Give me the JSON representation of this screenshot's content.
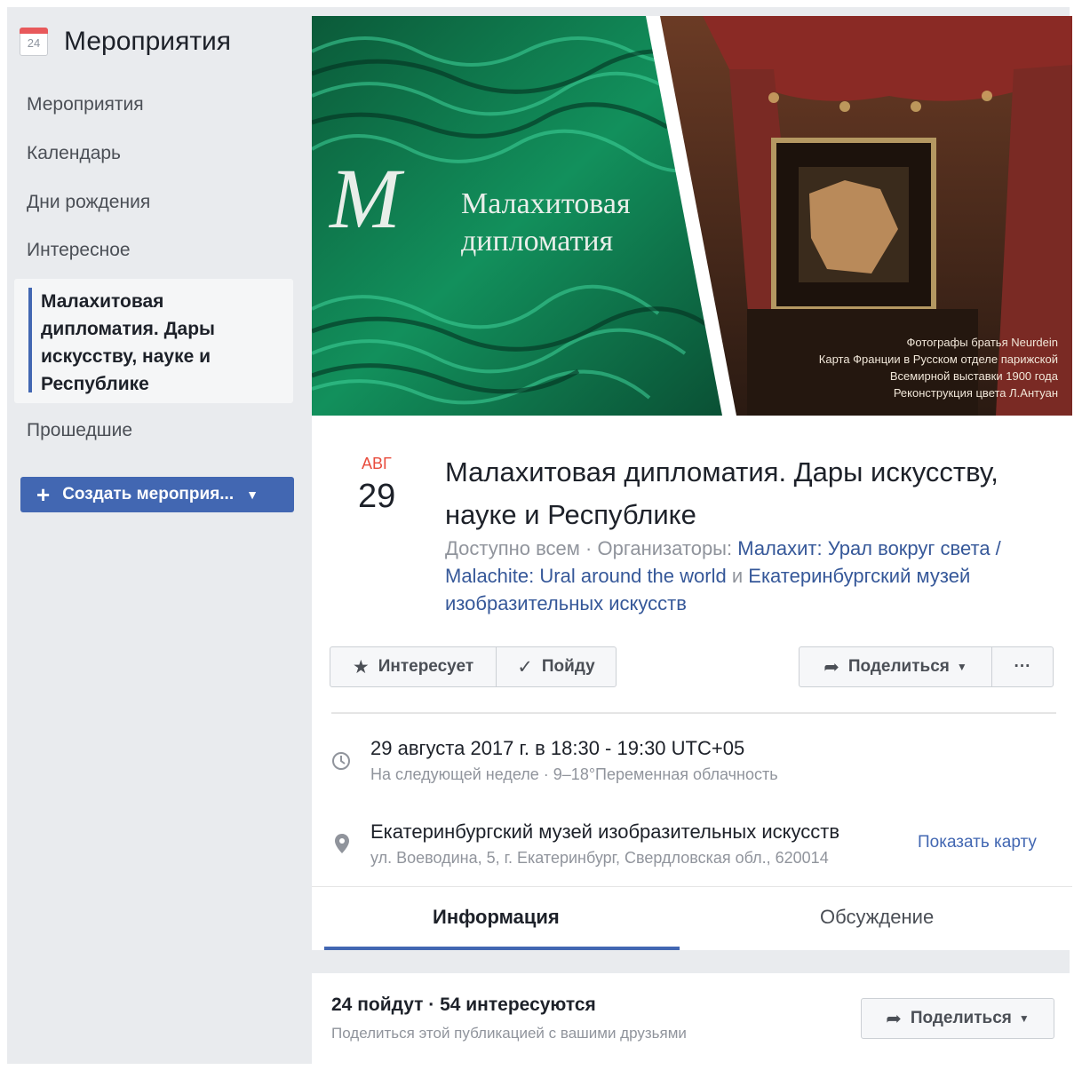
{
  "sidebar": {
    "icon_day": "24",
    "title": "Мероприятия",
    "items": [
      {
        "label": "Мероприятия"
      },
      {
        "label": "Календарь"
      },
      {
        "label": "Дни рождения"
      },
      {
        "label": "Интересное"
      },
      {
        "label": "Малахитовая дипломатия. Дары искусству, науке и Республике"
      },
      {
        "label": "Прошедшие"
      }
    ],
    "create_button": "Создать мероприя..."
  },
  "cover": {
    "title_line1": "Малахитовая",
    "title_line2": "дипломатия",
    "caption_lines": [
      "Фотографы братья Neurdein",
      "Карта Франции в Русском отделе парижской",
      "Всемирной выставки 1900 года",
      "Реконструкция цвета Л.Антуан"
    ]
  },
  "event": {
    "month": "АВГ",
    "day": "29",
    "title": "Малахитовая дипломатия. Дары искусству, науке и Республике",
    "access": "Доступно всем",
    "organizers_prefix": "· Организаторы:",
    "organizer1": "Малахит: Урал вокруг света / Malachite: Ural around the world",
    "conjunction": "и",
    "organizer2": "Екатеринбургский музей изобразительных искусств"
  },
  "actions": {
    "interested": "Интересует",
    "going": "Пойду",
    "share": "Поделиться",
    "more": "···"
  },
  "details": {
    "datetime": "29 августа 2017 г. в 18:30 - 19:30 UTC+05",
    "datetime_sub": "На следующей неделе · 9–18°Переменная облачность",
    "place": "Екатеринбургский музей изобразительных искусств",
    "address": "ул. Воеводина, 5, г. Екатеринбург, Свердловская обл., 620014",
    "show_map": "Показать карту"
  },
  "tabs": [
    {
      "label": "Информация",
      "active": true
    },
    {
      "label": "Обсуждение",
      "active": false
    }
  ],
  "attendance": {
    "summary": "24 пойдут · 54 интересуются",
    "sub": "Поделиться этой публикацией с вашими друзьями",
    "share": "Поделиться"
  },
  "colors": {
    "accent": "#4267b2",
    "link": "#365899",
    "month": "#e84c3d",
    "malachite": "#0f7a4f"
  }
}
